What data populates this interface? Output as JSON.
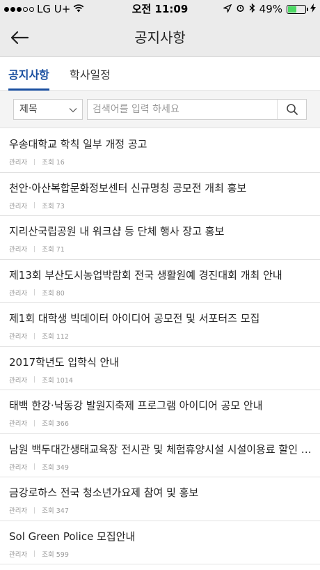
{
  "status_bar": {
    "carrier": "LG U+",
    "time": "오전 11:09",
    "battery_percent": "49%",
    "battery_level": 0.49
  },
  "header": {
    "title": "공지사항",
    "back_icon": "arrow-left-icon"
  },
  "tabs": [
    {
      "label": "공지사항",
      "active": true
    },
    {
      "label": "학사일정",
      "active": false
    }
  ],
  "search": {
    "category_selected": "제목",
    "placeholder": "검색어를 입력 하세요",
    "value": ""
  },
  "notices": [
    {
      "title": "우송대학교 학칙 일부 개정 공고",
      "author": "관리자",
      "views": "조회 16"
    },
    {
      "title": "천안·아산복합문화정보센터 신규명칭 공모전 개최 홍보",
      "author": "관리자",
      "views": "조회 73"
    },
    {
      "title": "지리산국립공원 내 워크샵 등 단체 행사 장고 홍보",
      "author": "관리자",
      "views": "조회 71"
    },
    {
      "title": "제13회 부산도시농업박람회 전국 생활원예 경진대회 개최 안내",
      "author": "관리자",
      "views": "조회 80"
    },
    {
      "title": "제1회 대학생 빅데이터 아이디어 공모전 및 서포터즈 모집",
      "author": "관리자",
      "views": "조회 112"
    },
    {
      "title": "2017학년도 입학식 안내",
      "author": "관리자",
      "views": "조회 1014"
    },
    {
      "title": "태백 한강·낙동강 발원지축제 프로그램 아이디어 공모 안내",
      "author": "관리자",
      "views": "조회 366"
    },
    {
      "title": "남원 백두대간생태교육장 전시관 및 체험휴양시설 시설이용료 할인 …",
      "author": "관리자",
      "views": "조회 349"
    },
    {
      "title": "금강로하스 전국 청소년가요제 참여 및 홍보",
      "author": "관리자",
      "views": "조회 347"
    },
    {
      "title": "Sol Green Police 모집안내",
      "author": "관리자",
      "views": "조회 599"
    }
  ]
}
